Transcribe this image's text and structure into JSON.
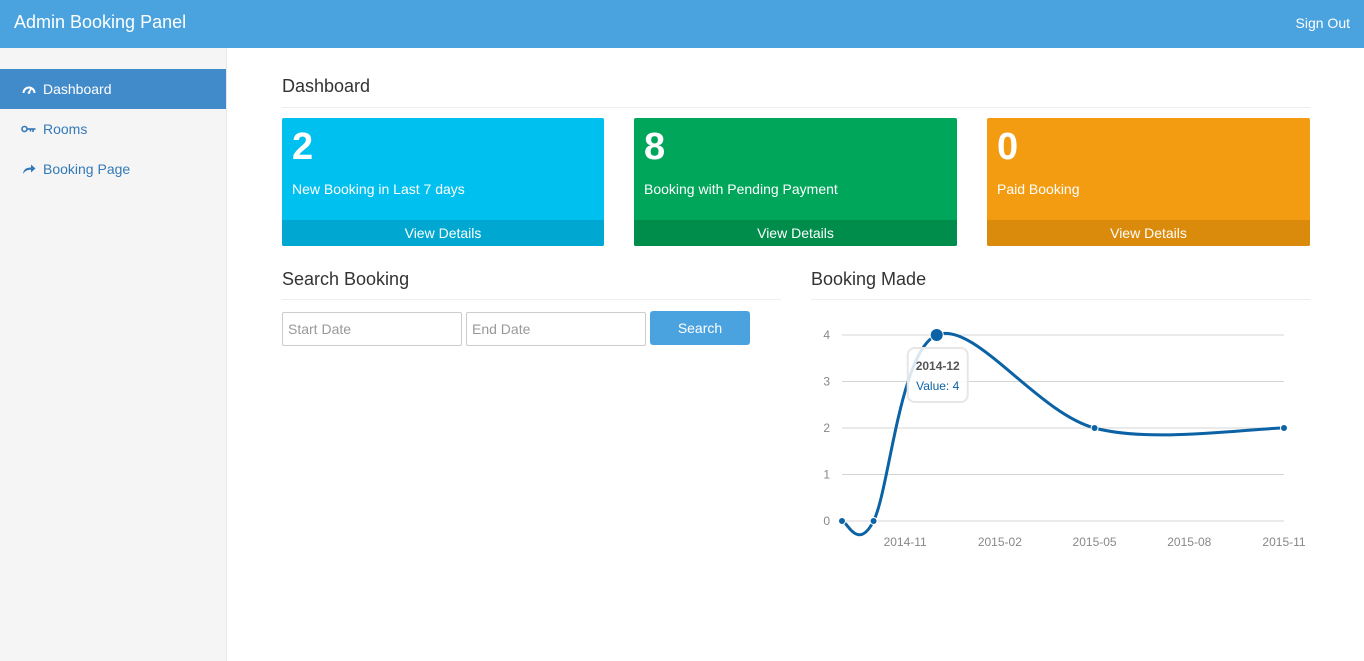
{
  "navbar": {
    "brand": "Admin Booking Panel",
    "sign_out": "Sign Out"
  },
  "sidebar": {
    "items": [
      {
        "label": "Dashboard",
        "icon": "dashboard-icon",
        "active": true
      },
      {
        "label": "Rooms",
        "icon": "key-icon",
        "active": false
      },
      {
        "label": "Booking Page",
        "icon": "share-arrow-icon",
        "active": false
      }
    ]
  },
  "main": {
    "title": "Dashboard",
    "tiles": [
      {
        "value": "2",
        "label": "New Booking in Last 7 days",
        "link": "View Details",
        "color": "#00c0ef",
        "footer_color": "#00a7d0"
      },
      {
        "value": "8",
        "label": "Booking with Pending Payment",
        "link": "View Details",
        "color": "#00a65a",
        "footer_color": "#008d4c"
      },
      {
        "value": "0",
        "label": "Paid Booking",
        "link": "View Details",
        "color": "#f39c12",
        "footer_color": "#db8b0b"
      }
    ],
    "search": {
      "title": "Search Booking",
      "start_placeholder": "Start Date",
      "end_placeholder": "End Date",
      "button": "Search"
    },
    "chart_title": "Booking Made"
  },
  "chart_data": {
    "type": "line",
    "x": [
      "2014-09",
      "2014-10",
      "2014-12",
      "2015-05",
      "2015-11"
    ],
    "series": [
      {
        "values": [
          0,
          0,
          4,
          2,
          2
        ]
      }
    ],
    "x_ticks": [
      "2014-11",
      "2015-02",
      "2015-05",
      "2015-08",
      "2015-11"
    ],
    "y_ticks": [
      0,
      1,
      2,
      3,
      4
    ],
    "ylim": [
      0,
      4
    ],
    "grid": true,
    "line_color": "#0b62a4",
    "tooltip": {
      "title": "2014-12",
      "text": "Value: 4"
    }
  }
}
